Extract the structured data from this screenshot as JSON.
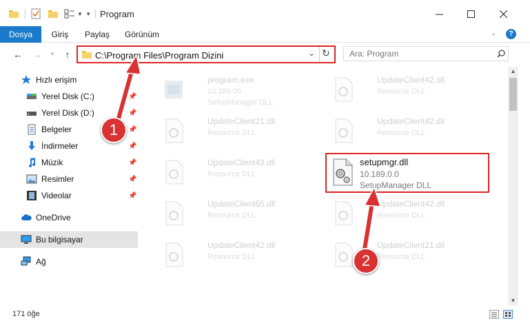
{
  "window": {
    "title": "Program",
    "minimize_icon": "minimize-icon",
    "maximize_icon": "maximize-icon",
    "close_icon": "close-icon"
  },
  "ribbon": {
    "tabs": [
      {
        "label": "Dosya"
      },
      {
        "label": "Giriş"
      },
      {
        "label": "Paylaş"
      },
      {
        "label": "Görünüm"
      }
    ]
  },
  "address": {
    "path": "C:\\Program Files\\Program Dizini"
  },
  "search": {
    "placeholder": "Ara: Program"
  },
  "sidebar": {
    "items": [
      {
        "label": "Hızlı erişim",
        "icon": "star-icon"
      },
      {
        "label": "Yerel Disk (C:)",
        "icon": "drive-icon"
      },
      {
        "label": "Yerel Disk (D:)",
        "icon": "drive-icon"
      },
      {
        "label": "Belgeler",
        "icon": "document-icon"
      },
      {
        "label": "İndirmeler",
        "icon": "download-icon"
      },
      {
        "label": "Müzik",
        "icon": "music-icon"
      },
      {
        "label": "Resimler",
        "icon": "pictures-icon"
      },
      {
        "label": "Videolar",
        "icon": "video-icon"
      },
      {
        "label": "OneDrive",
        "icon": "cloud-icon"
      },
      {
        "label": "Bu bilgisayar",
        "icon": "computer-icon"
      },
      {
        "label": "Ağ",
        "icon": "network-icon"
      }
    ]
  },
  "files": [
    {
      "name": "program.exe",
      "line2": "10.189.00",
      "line3": "SetupManager DLL"
    },
    {
      "name": "UpdateClient42.dll",
      "line2": "Resource DLL",
      "line3": ""
    },
    {
      "name": "UpdateClient21.dll",
      "line2": "Resource DLL",
      "line3": ""
    },
    {
      "name": "UpdateClient42.dll",
      "line2": "Resource DLL",
      "line3": ""
    },
    {
      "name": "UpdateClient42.dll",
      "line2": "Resource DLL",
      "line3": ""
    },
    {
      "name": "UpdateClient65.dll",
      "line2": "Resource DLL",
      "line3": ""
    },
    {
      "name": "UpdateClient42.dll",
      "line2": "Resource DLL",
      "line3": ""
    },
    {
      "name": "UpdateClient42.dll",
      "line2": "Resource DLL",
      "line3": ""
    },
    {
      "name": "UpdateClient21.dll",
      "line2": "Resource DLL",
      "line3": ""
    }
  ],
  "highlighted_file": {
    "name": "setupmgr.dll",
    "version": "10.189.0.0",
    "description": "SetupManager DLL"
  },
  "status": {
    "count": "171 öğe"
  },
  "callouts": {
    "one": "1",
    "two": "2"
  },
  "colors": {
    "accent": "#1979ca",
    "highlight": "#e02222",
    "callout": "#d83232"
  }
}
